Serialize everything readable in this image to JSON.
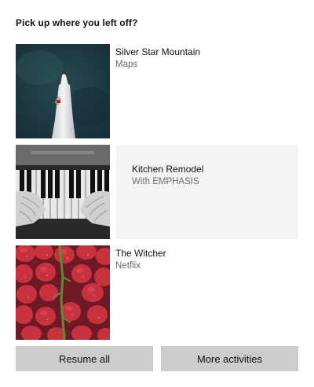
{
  "heading": "Pick up where you left off?",
  "activities": [
    {
      "title": "Silver Star Mountain",
      "subtitle": "Maps",
      "thumbnail": "figure-in-white-dress-photo"
    },
    {
      "title": "Kitchen Remodel",
      "subtitle": "With EMPHASIS",
      "thumbnail": "piano-keys-photo"
    },
    {
      "title": "The Witcher",
      "subtitle": "Netflix",
      "thumbnail": "strawberries-photo"
    }
  ],
  "buttons": {
    "resume_all": "Resume all",
    "more_activities": "More activities"
  },
  "colors": {
    "button_bg": "#cccccc",
    "selected_panel_bg": "#f4f4f4",
    "subtitle_text": "#6b6b6b"
  }
}
